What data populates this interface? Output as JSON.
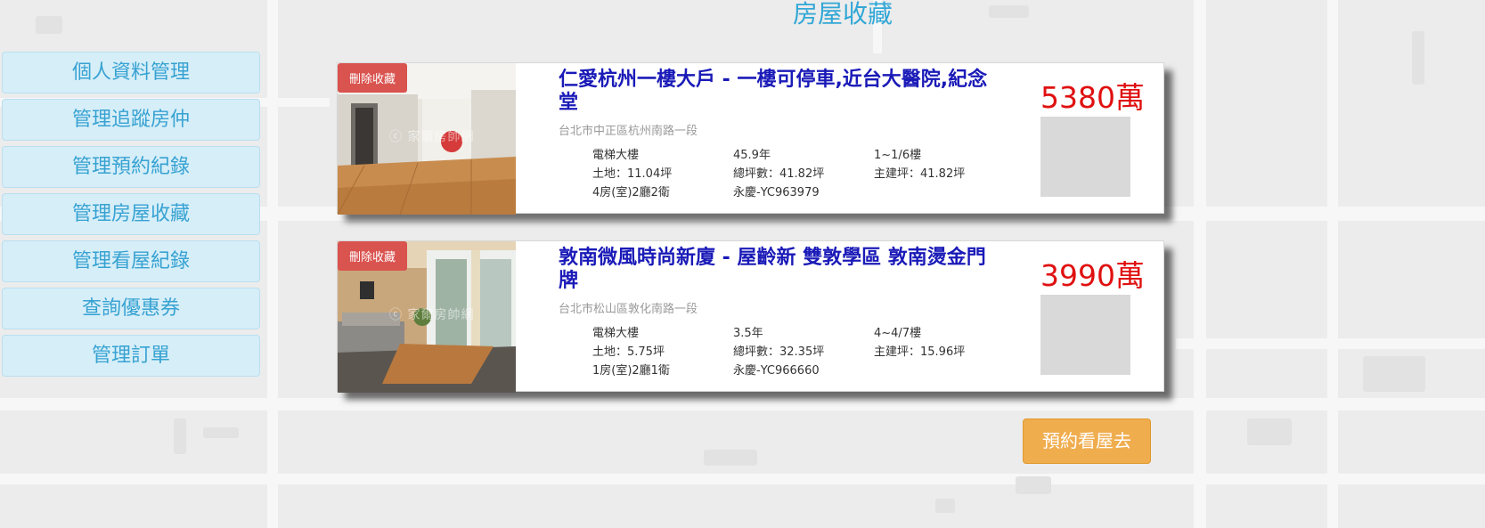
{
  "page": {
    "title": "房屋收藏"
  },
  "menu": {
    "items": [
      {
        "label": "個人資料管理"
      },
      {
        "label": "管理追蹤房仲"
      },
      {
        "label": "管理預約紀錄"
      },
      {
        "label": "管理房屋收藏"
      },
      {
        "label": "管理看屋紀錄"
      },
      {
        "label": "查詢優惠券"
      },
      {
        "label": "管理訂單"
      }
    ]
  },
  "listings": [
    {
      "remove_label": "刪除收藏",
      "watermark": "ⓒ 家爾房帥網",
      "title": "仁愛杭州一樓大戶 - 一樓可停車,近台大醫院,紀念堂",
      "address": "台北市中正區杭州南路一段",
      "specs": [
        "電梯大樓",
        "45.9年",
        "1~1/6樓",
        "土地：11.04坪",
        "總坪數：41.82坪",
        "主建坪：41.82坪",
        "4房(室)2廳2衛",
        "永慶-YC963979"
      ],
      "price": "5380萬"
    },
    {
      "remove_label": "刪除收藏",
      "watermark": "ⓒ 家爾房帥網",
      "title": "敦南微風時尚新廈 - 屋齡新 雙敦學區 敦南燙金門牌",
      "address": "台北市松山區敦化南路一段",
      "specs": [
        "電梯大樓",
        "3.5年",
        "4~4/7樓",
        "土地：5.75坪",
        "總坪數：32.35坪",
        "主建坪：15.96坪",
        "1房(室)2廳1衛",
        "永慶-YC966660"
      ],
      "price": "3990萬"
    }
  ],
  "actions": {
    "book_label": "預約看屋去"
  },
  "colors": {
    "accent": "#32a7d6",
    "price": "#e01010",
    "title_link": "#1a1ab8",
    "remove": "#d9534f",
    "book": "#f0ad4e"
  }
}
